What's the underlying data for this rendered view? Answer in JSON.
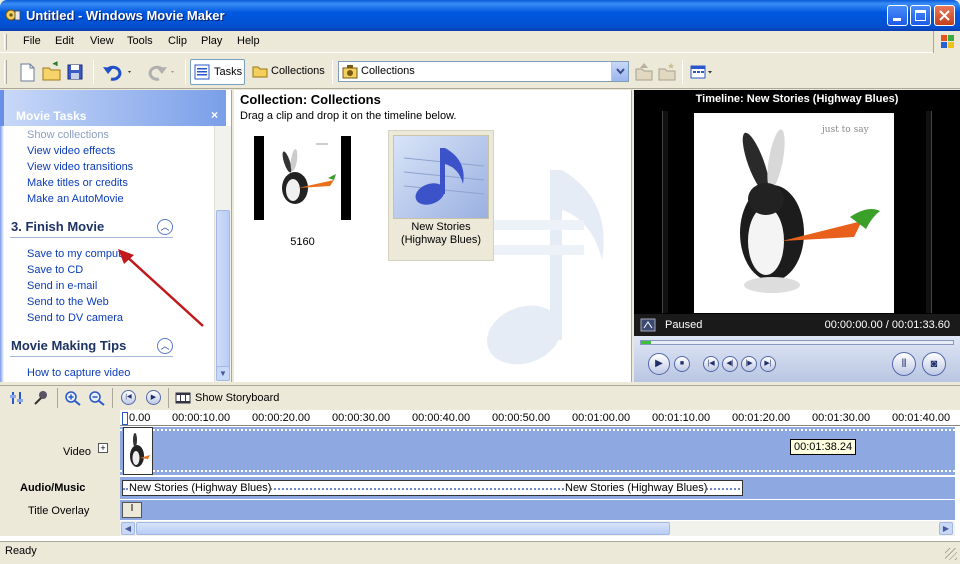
{
  "window": {
    "title": "Untitled - Windows Movie Maker"
  },
  "menu": {
    "items": [
      "File",
      "Edit",
      "View",
      "Tools",
      "Clip",
      "Play",
      "Help"
    ]
  },
  "toolbar": {
    "tasks_label": "Tasks",
    "collections_label": "Collections",
    "collections_dropdown_value": "Collections"
  },
  "task_pane": {
    "header": "Movie Tasks",
    "close_symbol": "×",
    "edit_links": [
      "Show collections",
      "View video effects",
      "View video transitions",
      "Make titles or credits",
      "Make an AutoMovie"
    ],
    "finish_title": "3. Finish Movie",
    "finish_links": [
      "Save to my comput",
      "Save to CD",
      "Send in e-mail",
      "Send to the Web",
      "Send to DV camera"
    ],
    "tips_title": "Movie Making Tips",
    "tips_links": [
      "How to capture video"
    ]
  },
  "collection": {
    "title": "Collection: Collections",
    "subtitle": "Drag a clip and drop it on the timeline below.",
    "items": [
      {
        "label": "5160"
      },
      {
        "label": "New Stories (Highway Blues)"
      }
    ]
  },
  "preview": {
    "title": "Timeline: New Stories (Highway Blues)",
    "image_caption": "just to say",
    "state": "Paused",
    "time": "00:00:00.00 / 00:01:33.60"
  },
  "timeline": {
    "show_storyboard_label": "Show Storyboard",
    "ruler_labels": [
      "0.00",
      "00:00:10.00",
      "00:00:20.00",
      "00:00:30.00",
      "00:00:40.00",
      "00:00:50.00",
      "00:01:00.00",
      "00:01:10.00",
      "00:01:20.00",
      "00:01:30.00",
      "00:01:40.00"
    ],
    "track_labels": {
      "video": "Video",
      "audio": "Audio/Music",
      "overlay": "Title Overlay"
    },
    "audio_clip_label": "New Stories (Highway Blues)",
    "tooltip": "00:01:38.24"
  },
  "status": {
    "text": "Ready"
  },
  "colors": {
    "titlebar": "#0058e0",
    "link": "#0b3cba",
    "track": "#8ea8e2",
    "arrow": "#c0181c"
  }
}
